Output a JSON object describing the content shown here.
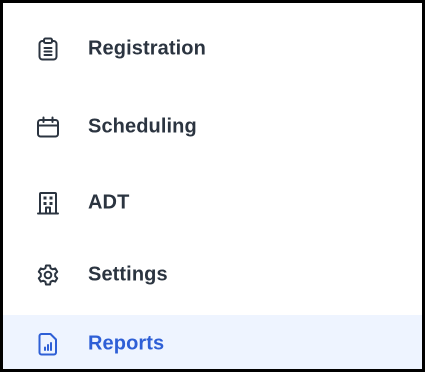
{
  "colors": {
    "text": "#2b3440",
    "icon": "#2b3440",
    "active_text": "#2e5fd6",
    "active_icon": "#2e5fd6",
    "active_background": "#eef4ff",
    "frame_border": "#000000"
  },
  "menu": {
    "items": [
      {
        "label": "Registration",
        "icon": "clipboard-icon",
        "active": false
      },
      {
        "label": "Scheduling",
        "icon": "calendar-icon",
        "active": false
      },
      {
        "label": "ADT",
        "icon": "building-icon",
        "active": false
      },
      {
        "label": "Settings",
        "icon": "gear-icon",
        "active": false
      },
      {
        "label": "Reports",
        "icon": "report-chart-icon",
        "active": true
      }
    ]
  }
}
